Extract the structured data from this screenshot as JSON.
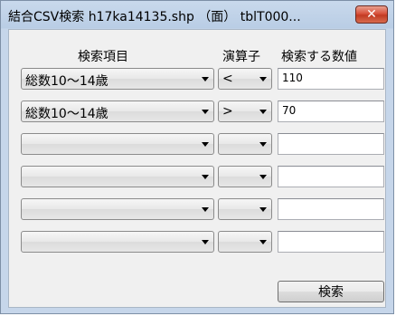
{
  "window": {
    "title": "結合CSV検索 h17ka14135.shp （面） tblT000...",
    "close_glyph": "✕"
  },
  "headers": {
    "item": "検索項目",
    "operator": "演算子",
    "value": "検索する数値"
  },
  "rows": [
    {
      "item": "総数10〜14歳",
      "operator": "<",
      "value": "110"
    },
    {
      "item": "総数10〜14歳",
      "operator": ">",
      "value": "70"
    },
    {
      "item": "",
      "operator": "",
      "value": ""
    },
    {
      "item": "",
      "operator": "",
      "value": ""
    },
    {
      "item": "",
      "operator": "",
      "value": ""
    },
    {
      "item": "",
      "operator": "",
      "value": ""
    }
  ],
  "search_button": {
    "label": "検索"
  }
}
